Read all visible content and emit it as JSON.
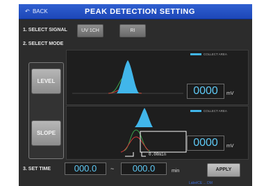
{
  "header": {
    "back_label": "BACK",
    "title": "PEAK DETECTION SETTING"
  },
  "select_signal": {
    "label": "1. SELECT SIGNAL",
    "options": [
      "UV 1CH",
      "RI"
    ]
  },
  "select_mode": {
    "label": "2. SELECT MODE",
    "level_label": "LEVEL",
    "slope_label": "SLOPE"
  },
  "level_panel": {
    "legend": "COLLECT AREA",
    "value": "0000",
    "unit": "mV"
  },
  "slope_panel": {
    "legend": "COLLECT AREA",
    "value": "0000",
    "unit": "mV",
    "time_label": "0.00min"
  },
  "set_time": {
    "label": "3. SET TIME",
    "start": "000.0",
    "separator": "~",
    "end": "000.0",
    "unit": "min"
  },
  "apply_label": "APPLY",
  "footer": "LabelCE  ...  DM",
  "colors": {
    "header": "#2454c4",
    "peak_fill": "#41b6ea",
    "readout": "#5ec9f5",
    "curve_red": "#d23a3a",
    "curve_green": "#3aa54a"
  }
}
